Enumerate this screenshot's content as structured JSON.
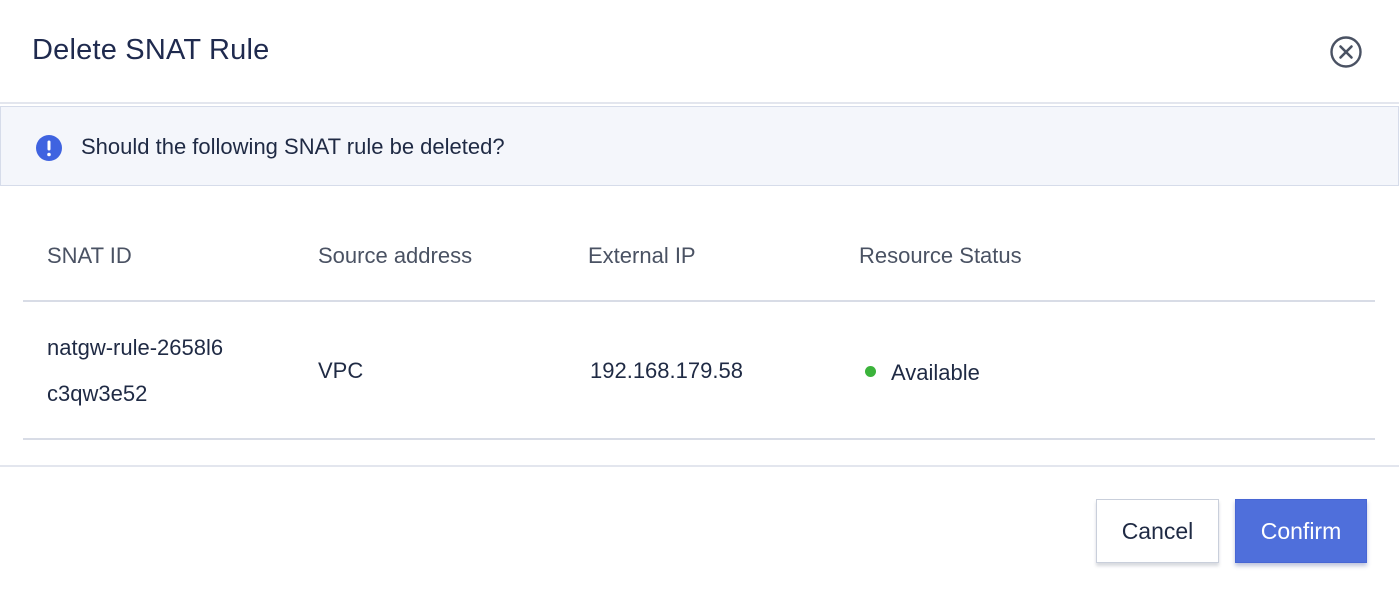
{
  "dialog": {
    "title": "Delete SNAT Rule",
    "close_icon": "close-circle-icon"
  },
  "alert": {
    "icon": "exclamation-circle-icon",
    "message": "Should the following SNAT rule be deleted?"
  },
  "table": {
    "headers": [
      "SNAT ID",
      "Source address",
      "External IP",
      "Resource Status"
    ],
    "rows": [
      {
        "snat_id_line1": "natgw-rule-2658l6",
        "snat_id_line2": "c3qw3e52",
        "source_address": "VPC",
        "external_ip": "192.168.179.58",
        "status": "Available",
        "status_color": "#3bb33b"
      }
    ]
  },
  "footer": {
    "cancel_label": "Cancel",
    "confirm_label": "Confirm"
  },
  "colors": {
    "accent": "#4f6fdb",
    "alert_icon": "#3f63e0"
  }
}
